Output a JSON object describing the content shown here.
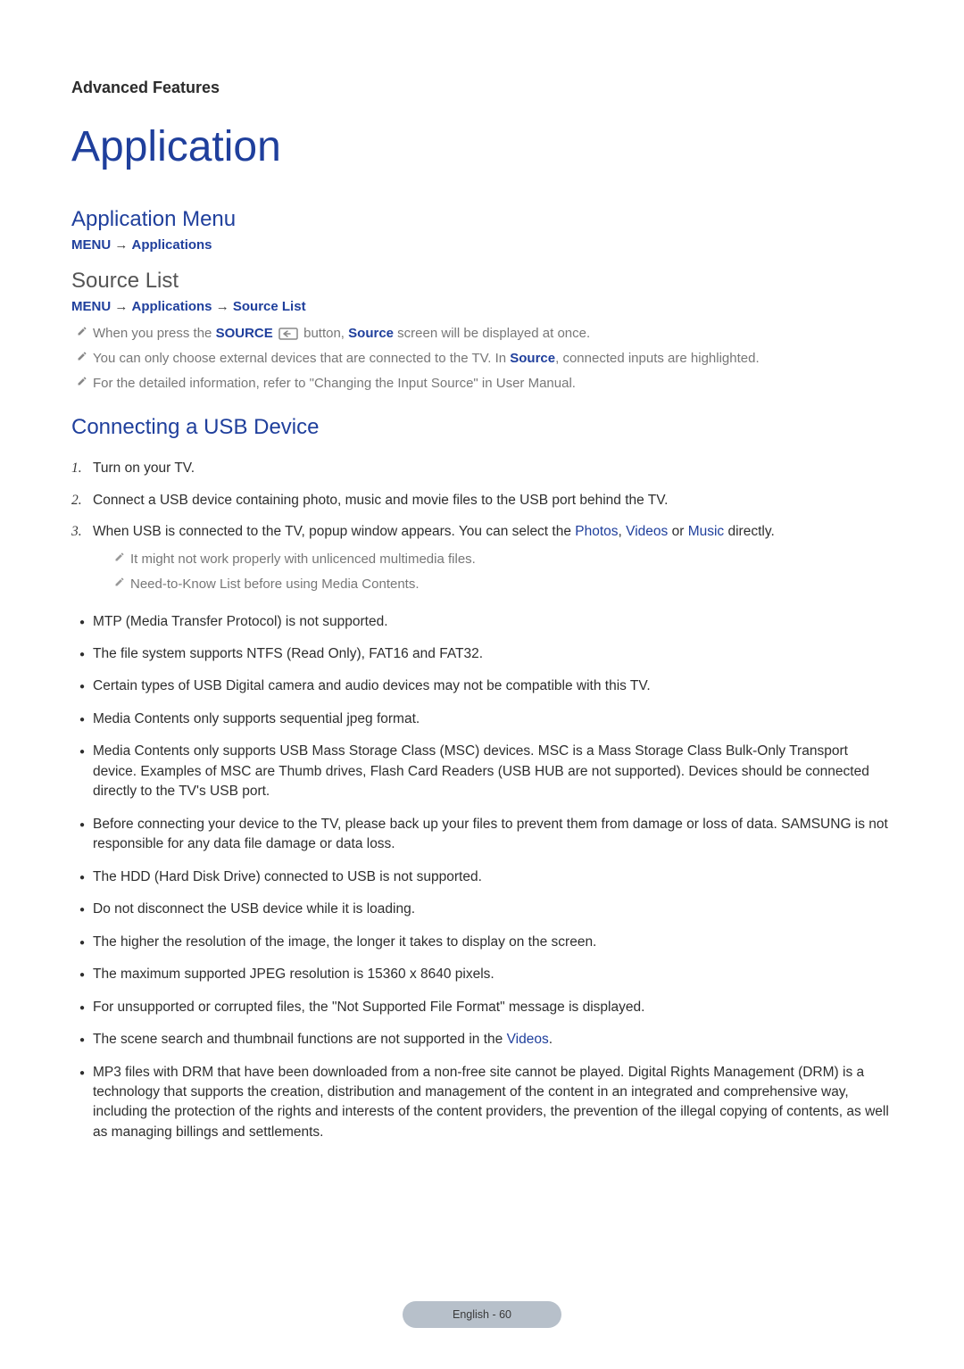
{
  "section_label": "Advanced Features",
  "page_title": "Application",
  "app_menu": {
    "heading": "Application Menu",
    "path": {
      "menu": "MENU",
      "arrow": "→",
      "applications": "Applications"
    }
  },
  "source_list": {
    "heading": "Source List",
    "path": {
      "menu": "MENU",
      "arrow": "→",
      "applications": "Applications",
      "source_list": "Source List"
    },
    "notes": [
      {
        "pre": "When you press the ",
        "source_btn": "SOURCE",
        "mid": " button, ",
        "source_word": "Source",
        "post": " screen will be displayed at once."
      },
      {
        "pre": "You can only choose external devices that are connected to the TV. In ",
        "source_word": "Source",
        "post": ", connected inputs are highlighted."
      },
      {
        "plain": "For the detailed information, refer to \"Changing the Input Source\" in User Manual."
      }
    ]
  },
  "usb": {
    "heading": "Connecting a USB Device",
    "steps": [
      {
        "num": "1.",
        "text": "Turn on your TV."
      },
      {
        "num": "2.",
        "text": "Connect a USB device containing photo, music and movie files to the USB port behind the TV."
      },
      {
        "num": "3.",
        "pre": "When USB is connected to the TV, popup window appears. You can select the ",
        "photos": "Photos",
        "c1": ", ",
        "videos": "Videos",
        "c2": " or ",
        "music": "Music",
        "post": " directly.",
        "subnotes": [
          "It might not work properly with unlicenced multimedia files.",
          "Need-to-Know List before using Media Contents."
        ]
      }
    ],
    "bullets": [
      {
        "text": "MTP (Media Transfer Protocol) is not supported."
      },
      {
        "text": "The file system supports NTFS (Read Only), FAT16 and FAT32."
      },
      {
        "text": "Certain types of USB Digital camera and audio devices may not be compatible with this TV."
      },
      {
        "text": "Media Contents only supports sequential jpeg format."
      },
      {
        "text": "Media Contents only supports USB Mass Storage Class (MSC) devices. MSC is a Mass Storage Class Bulk-Only Transport device. Examples of MSC are Thumb drives, Flash Card Readers (USB HUB are not supported). Devices should be connected directly to the TV's USB port."
      },
      {
        "text": "Before connecting your device to the TV, please back up your files to prevent them from damage or loss of data. SAMSUNG is not responsible for any data file damage or data loss."
      },
      {
        "text": "The HDD (Hard Disk Drive) connected to USB is not supported."
      },
      {
        "text": "Do not disconnect the USB device while it is loading."
      },
      {
        "text": "The higher the resolution of the image, the longer it takes to display on the screen."
      },
      {
        "text": "The maximum supported JPEG resolution is 15360 x 8640 pixels."
      },
      {
        "text": "For unsupported or corrupted files, the \"Not Supported File Format\" message is displayed."
      },
      {
        "pre": "The scene search and thumbnail functions are not supported in the ",
        "videos": "Videos",
        "post": "."
      },
      {
        "text": "MP3 files with DRM that have been downloaded from a non-free site cannot be played. Digital Rights Management (DRM) is a technology that supports the creation, distribution and management of the content in an integrated and comprehensive way, including the protection of the rights and interests of the content providers, the prevention of the illegal copying of contents, as well as managing billings and settlements."
      }
    ]
  },
  "footer": "English - 60"
}
